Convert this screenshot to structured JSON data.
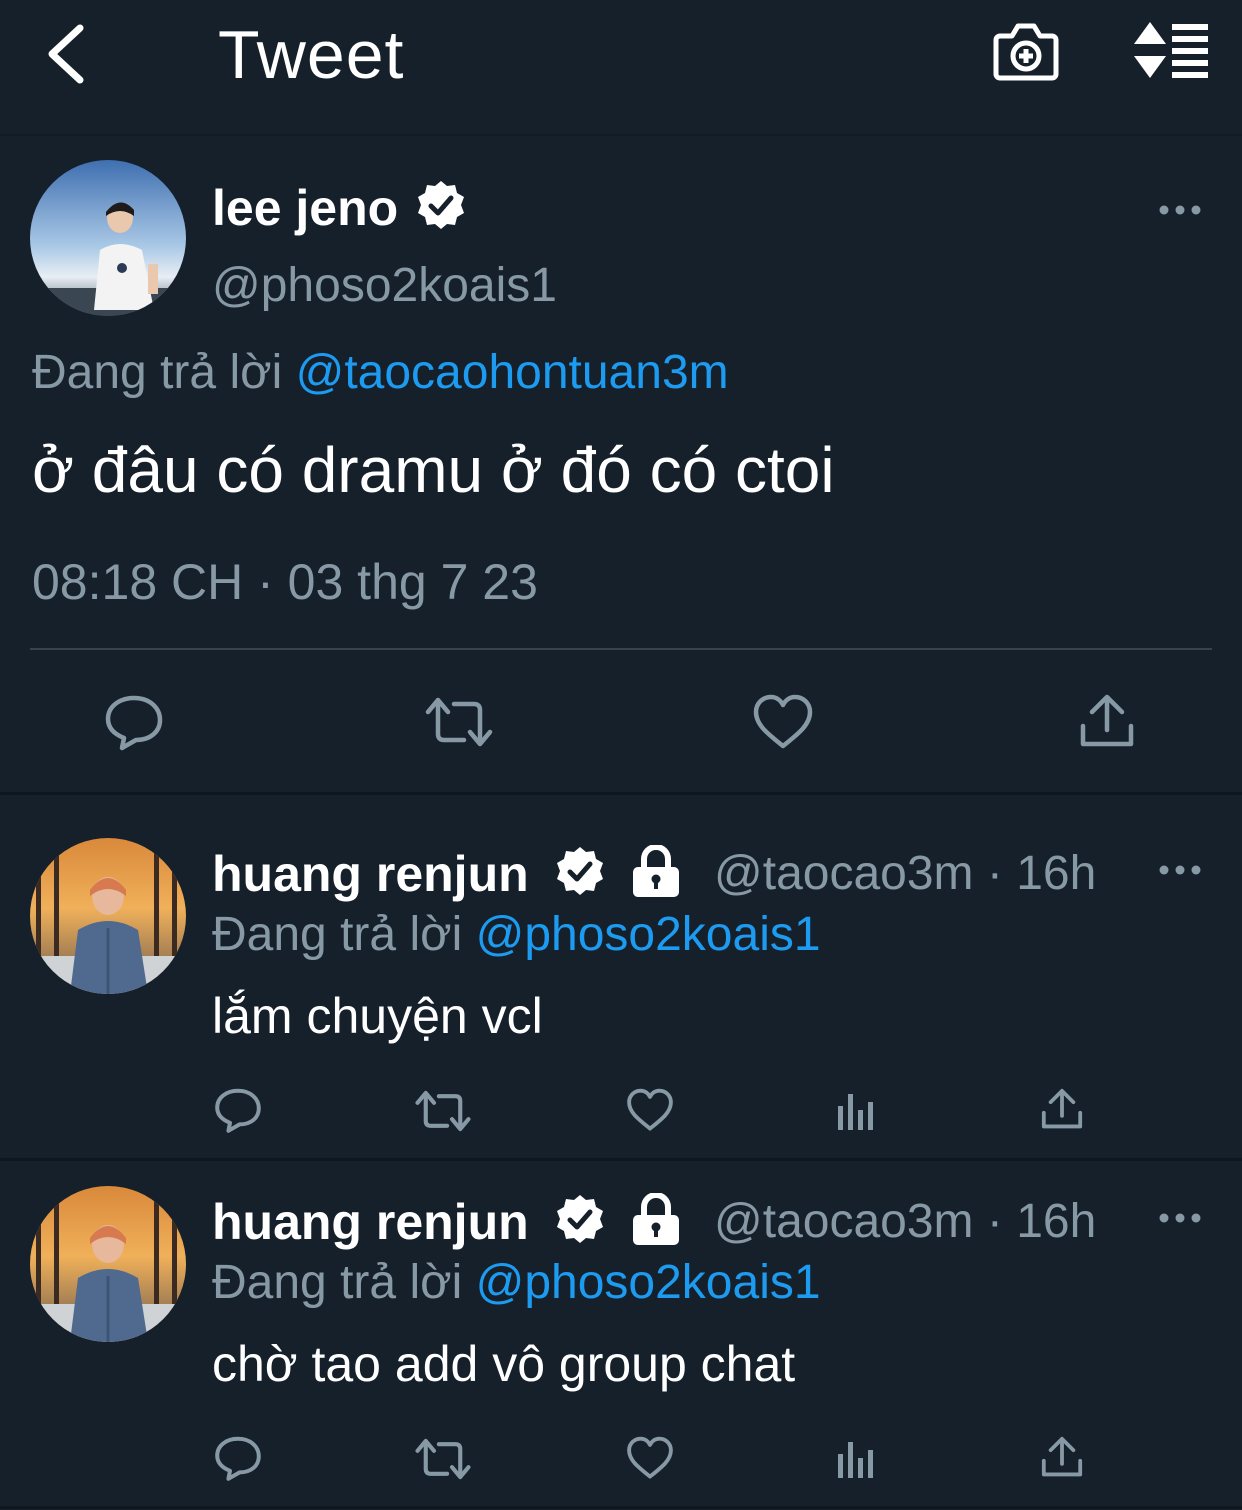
{
  "header": {
    "title": "Tweet"
  },
  "main_tweet": {
    "name": "lee jeno",
    "handle": "@phoso2koais1",
    "reply_prefix": "Đang trả lời",
    "reply_to": "@taocaohontuan3m",
    "text": "ở đâu có dramu ở đó có ctoi",
    "timestamp": "08:18 CH · 03 thg 7 23"
  },
  "replies": [
    {
      "name": "huang renjun",
      "handle": "@taocao3m",
      "separator": "·",
      "time": "16h",
      "reply_prefix": "Đang trả lời",
      "reply_to": "@phoso2koais1",
      "text": "lắm chuyện vcl"
    },
    {
      "name": "huang renjun",
      "handle": "@taocao3m",
      "separator": "·",
      "time": "16h",
      "reply_prefix": "Đang trả lời",
      "reply_to": "@phoso2koais1",
      "text": "chờ tao add vô group chat"
    }
  ],
  "colors": {
    "background": "#15202b",
    "text": "#ffffff",
    "muted": "#8899a6",
    "link": "#1d9bf0",
    "divider": "#38444d"
  },
  "icons": [
    "back-arrow-icon",
    "camera-add-icon",
    "sort-icon",
    "verified-badge-icon",
    "lock-icon",
    "more-icon",
    "reply-icon",
    "retweet-icon",
    "like-icon",
    "analytics-icon",
    "share-icon"
  ]
}
